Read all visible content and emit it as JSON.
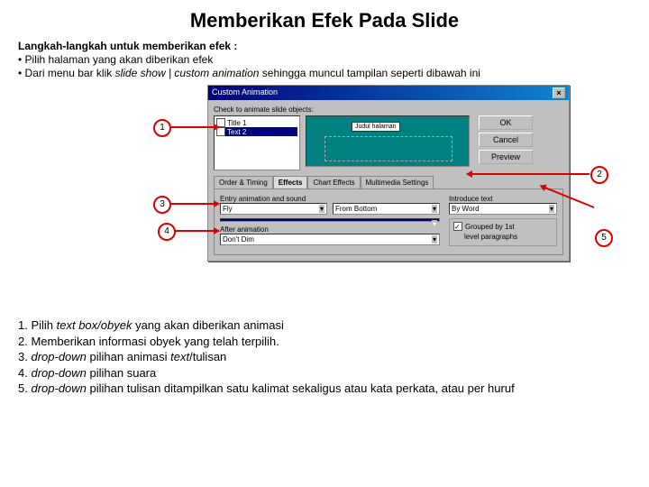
{
  "title": "Memberikan Efek Pada Slide",
  "intro": "Langkah-langkah untuk memberikan efek :",
  "bullet1_a": "Pilih halaman yang akan diberikan efek",
  "bullet2_a": "Dari menu bar klik ",
  "bullet2_b": "slide show | custom animation",
  "bullet2_c": " sehingga muncul tampilan seperti dibawah ini",
  "dialog": {
    "title": "Custom Animation",
    "check_caption": "Check to animate slide objects:",
    "item1": "Title 1",
    "item2": "Text 2",
    "preview_label": "Judul halaman",
    "btn_ok": "OK",
    "btn_cancel": "Cancel",
    "btn_preview": "Preview",
    "tab1": "Order & Timing",
    "tab2": "Effects",
    "tab3": "Chart Effects",
    "tab4": "Multimedia Settings",
    "entry_label": "Entry animation and sound",
    "anim_value": "Fly",
    "dir_value": "From Bottom",
    "sound_value": "",
    "intro_label": "Introduce text",
    "intro_value": "By Word",
    "grp_opt": "Grouped by 1st",
    "lvl_opt": "level paragraphs",
    "after_label": "After animation",
    "after_value": "Don't Dim"
  },
  "callouts": {
    "c1": "1",
    "c2": "2",
    "c3": "3",
    "c4": "4",
    "c5": "5"
  },
  "legend": {
    "l1a": "1. Pilih ",
    "l1b": "text box/obyek",
    "l1c": " yang akan diberikan animasi",
    "l2": "2. Memberikan informasi obyek yang telah terpilih.",
    "l3a": "3. ",
    "l3b": "drop-down",
    "l3c": " pilihan animasi ",
    "l3d": "text",
    "l3e": "/tulisan",
    "l4a": "4. ",
    "l4b": "drop-down",
    "l4c": " pilihan suara",
    "l5a": "5. ",
    "l5b": "drop-down",
    "l5c": " pilihan tulisan ditampilkan satu kalimat sekaligus atau kata perkata, atau per huruf"
  }
}
